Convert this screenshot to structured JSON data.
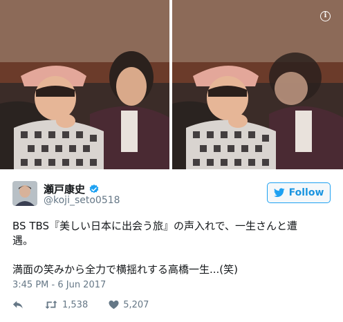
{
  "photos": {
    "left_alt": "",
    "right_alt": ""
  },
  "tweet": {
    "display_name": "瀬戸康史",
    "handle": "@koji_seto0518",
    "verified": true,
    "follow_label": "Follow",
    "text_line1": "BS TBS『美しい日本に出会う旅』の声入れで、一生さんと遭",
    "text_line2": "遇。",
    "text_line3": "満面の笑みから全力で横揺れする高橋一生...(笑)",
    "timestamp": "3:45 PM - 6 Jun 2017",
    "retweets": "1,538",
    "likes": "5,207"
  },
  "colors": {
    "brand": "#1da1f2",
    "text": "#14171a",
    "muted": "#657786"
  },
  "icons": {
    "info": "info-icon",
    "verified": "verified-badge-icon",
    "follow": "twitter-bird-icon",
    "reply": "reply-icon",
    "retweet": "retweet-icon",
    "like": "heart-icon"
  }
}
